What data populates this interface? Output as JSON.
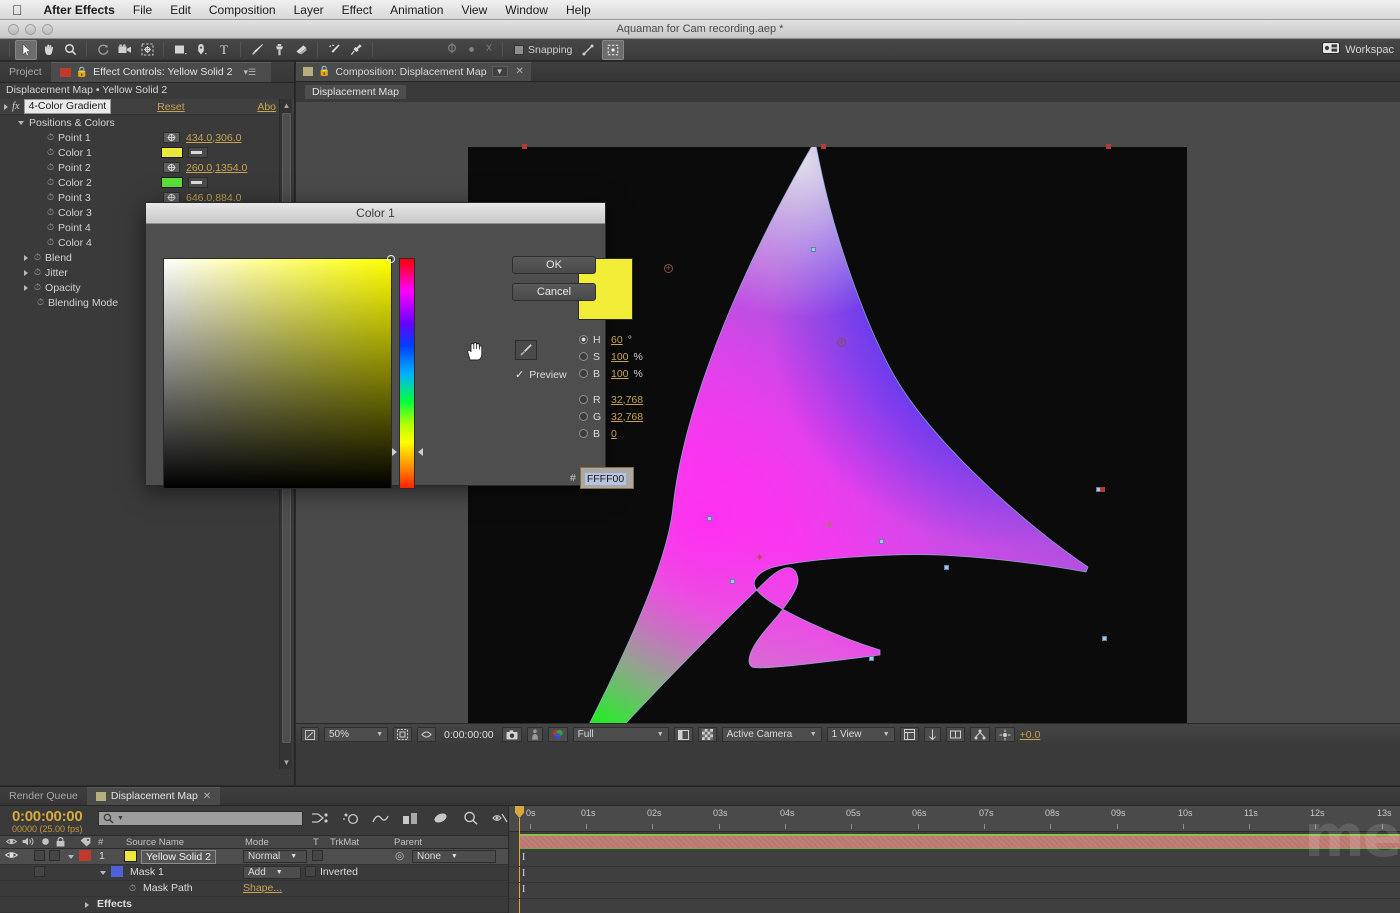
{
  "menubar": {
    "apple": "apple-logo",
    "app": "After Effects",
    "items": [
      "File",
      "Edit",
      "Composition",
      "Layer",
      "Effect",
      "Animation",
      "View",
      "Window",
      "Help"
    ]
  },
  "titlebar": {
    "document": "Aquaman for Cam recording.aep *"
  },
  "toolbar": {
    "tools": [
      "selection-tool",
      "hand-tool",
      "zoom-tool",
      "rotation-tool",
      "camera-tool",
      "pan-behind-tool",
      "shape-tool",
      "pen-tool",
      "type-tool",
      "brush-tool",
      "clone-stamp-tool",
      "eraser-tool",
      "roto-brush-tool",
      "puppet-pin-tool"
    ],
    "snapping_label": "Snapping",
    "workspace_label": "Workspac"
  },
  "effect_controls": {
    "tabs": [
      {
        "label": "Project",
        "active": false
      },
      {
        "label": "Effect Controls: Yellow Solid 2",
        "active": true
      }
    ],
    "subheader": "Displacement Map • Yellow Solid 2",
    "effect_name": "4-Color Gradient",
    "reset_label": "Reset",
    "about_label": "Abo",
    "group_label": "Positions & Colors",
    "properties": [
      {
        "label": "Point 1",
        "type": "point",
        "value": "434.0,306.0"
      },
      {
        "label": "Color 1",
        "type": "color",
        "swatch": "#ebe83c"
      },
      {
        "label": "Point 2",
        "type": "point",
        "value": "260.0,1354.0"
      },
      {
        "label": "Color 2",
        "type": "color",
        "swatch": "#5cdd3a"
      },
      {
        "label": "Point 3",
        "type": "point",
        "value": "646.0,884.0"
      },
      {
        "label": "Color 3",
        "type": "color",
        "swatch": "#3a6add"
      },
      {
        "label": "Point 4",
        "type": "point",
        "value": ""
      },
      {
        "label": "Color 4",
        "type": "color",
        "swatch": "#dd3ab4"
      }
    ],
    "extra_properties": [
      "Blend",
      "Jitter",
      "Opacity",
      "Blending Mode"
    ]
  },
  "composition": {
    "tab_label": "Composition: Displacement Map",
    "breadcrumb": "Displacement Map",
    "footer": {
      "zoom": "50%",
      "time": "0:00:00:00",
      "resolution": "Full",
      "camera": "Active Camera",
      "views": "1 View",
      "exposure": "+0.0"
    }
  },
  "color_dialog": {
    "title": "Color 1",
    "ok_label": "OK",
    "cancel_label": "Cancel",
    "preview_label": "Preview",
    "preview_checked": true,
    "selected_color": "#f2ee37",
    "fields": [
      {
        "key": "H",
        "value": "60",
        "unit": "°",
        "selected": true
      },
      {
        "key": "S",
        "value": "100",
        "unit": "%",
        "selected": false
      },
      {
        "key": "B",
        "value": "100",
        "unit": "%",
        "selected": false
      },
      {
        "key": "R",
        "value": "32,768",
        "unit": "",
        "selected": false
      },
      {
        "key": "G",
        "value": "32,768",
        "unit": "",
        "selected": false
      },
      {
        "key": "B",
        "value": "0",
        "unit": "",
        "selected": false
      }
    ],
    "hex_prefix": "#",
    "hex_value": "FFFF00"
  },
  "timeline": {
    "tabs": [
      {
        "label": "Render Queue",
        "active": false
      },
      {
        "label": "Displacement Map",
        "active": true
      }
    ],
    "current_time": "0:00:00:00",
    "frame_info": "00000 (25.00 fps)",
    "search_placeholder": "",
    "columns": [
      "Source Name",
      "Mode",
      "T",
      "TrkMat",
      "Parent"
    ],
    "rows": [
      {
        "index": "1",
        "name": "Yellow Solid 2",
        "mode": "Normal",
        "parent": "None",
        "swatch": "#ebe83c",
        "label_color": "#c0392b"
      },
      {
        "index": "",
        "name": "Mask 1",
        "mode": "Add",
        "inverted_label": "Inverted",
        "swatch": "#5060d8"
      },
      {
        "index": "",
        "name": "Mask Path",
        "value_link": "Shape..."
      },
      {
        "index": "",
        "name": "Effects"
      }
    ],
    "ruler_ticks": [
      "0s",
      "01s",
      "02s",
      "03s",
      "04s",
      "05s",
      "06s",
      "07s",
      "08s",
      "09s",
      "10s",
      "11s",
      "12s",
      "13s"
    ],
    "watermark": "me"
  }
}
